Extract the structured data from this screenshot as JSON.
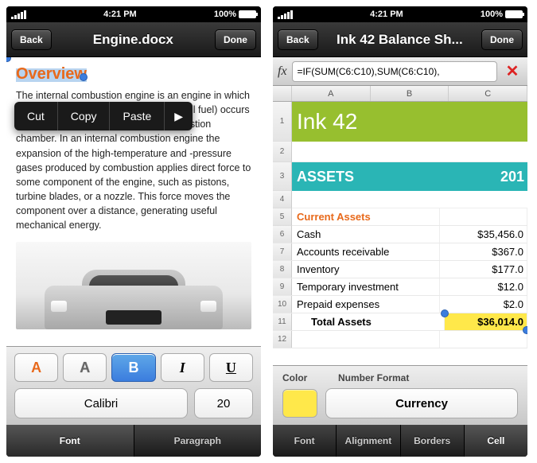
{
  "status": {
    "time": "4:21 PM",
    "battery": "100%"
  },
  "left": {
    "nav": {
      "back": "Back",
      "title": "Engine.docx",
      "done": "Done"
    },
    "heading": "Overview",
    "body": "The internal combustion engine is an engine in which the combustion of a fuel (generally, fossil fuel) occurs with an oxidizer (usually air) in a combustion chamber. In an internal combustion engine the expansion of the high-temperature and -pressure gases produced by combustion applies direct force to some component of the engine, such as pistons, turbine blades, or a nozzle. This force moves the component over a distance, generating useful mechanical energy.",
    "ctx": {
      "cut": "Cut",
      "copy": "Copy",
      "paste": "Paste"
    },
    "format": {
      "colorA": "A",
      "outlineA": "A",
      "bold": "B",
      "italic": "I",
      "underline": "U",
      "font": "Calibri",
      "size": "20"
    },
    "tabs": {
      "font": "Font",
      "paragraph": "Paragraph"
    }
  },
  "right": {
    "nav": {
      "back": "Back",
      "title": "Ink 42 Balance Sh...",
      "done": "Done"
    },
    "fx": {
      "label": "fx",
      "formula": "=IF(SUM(C6:C10),SUM(C6:C10),"
    },
    "cols": [
      "A",
      "B",
      "C"
    ],
    "titleBand": "Ink 42",
    "assets": {
      "label": "ASSETS",
      "year": "201"
    },
    "section": "Current Assets",
    "rows": [
      {
        "n": "6",
        "label": "Cash",
        "val": "$35,456.0"
      },
      {
        "n": "7",
        "label": "Accounts receivable",
        "val": "$367.0"
      },
      {
        "n": "8",
        "label": "Inventory",
        "val": "$177.0"
      },
      {
        "n": "9",
        "label": "Temporary investment",
        "val": "$12.0"
      },
      {
        "n": "10",
        "label": "Prepaid expenses",
        "val": "$2.0"
      }
    ],
    "total": {
      "n": "11",
      "label": "Total Assets",
      "val": "$36,014.0"
    },
    "rownums_top": [
      "1",
      "2",
      "3",
      "4",
      "5"
    ],
    "rownum_last": "12",
    "cellfmt": {
      "colorLabel": "Color",
      "nfLabel": "Number Format",
      "currency": "Currency"
    },
    "tabs": {
      "font": "Font",
      "align": "Alignment",
      "borders": "Borders",
      "cell": "Cell"
    }
  }
}
